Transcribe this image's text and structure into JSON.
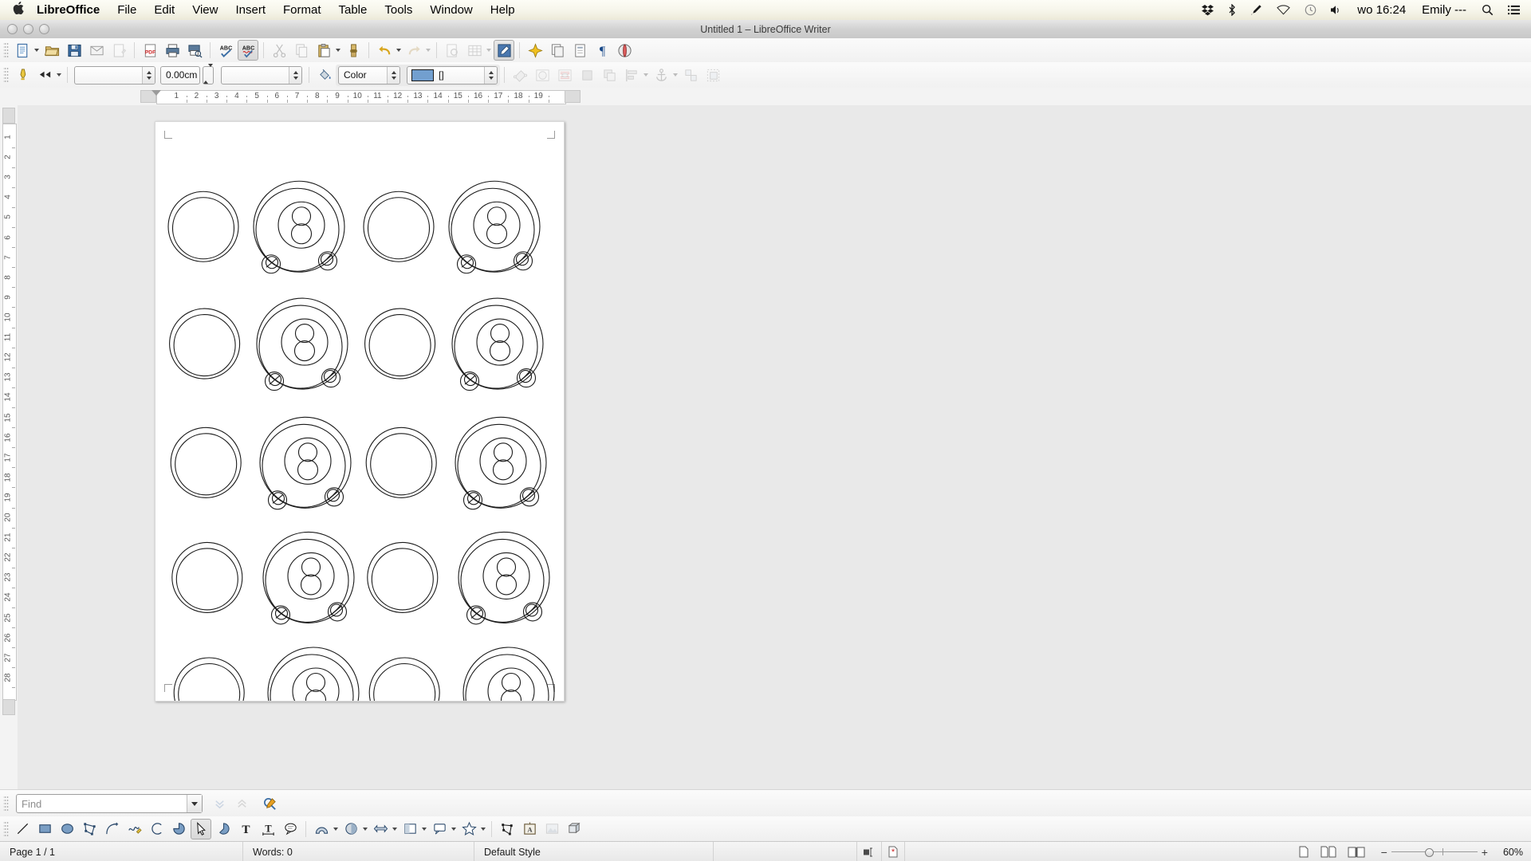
{
  "macbar": {
    "apple_icon": "apple-logo-icon",
    "app_name": "LibreOffice",
    "menus": [
      "File",
      "Edit",
      "View",
      "Insert",
      "Format",
      "Table",
      "Tools",
      "Window",
      "Help"
    ],
    "status_icons": [
      "dropbox-icon",
      "bluetooth-icon",
      "pen-icon",
      "wifi-icon",
      "time-machine-icon",
      "volume-icon"
    ],
    "clock": "wo 16:24",
    "user": "Emily ---",
    "search_icon": "spotlight-search-icon",
    "notification_icon": "notification-center-icon"
  },
  "titlebar": {
    "title": "Untitled 1 – LibreOffice Writer",
    "close_label": "close-window",
    "minimize_label": "minimize-window",
    "zoom_label": "zoom-window"
  },
  "toolbar_main": {
    "items": [
      {
        "name": "new-document-button",
        "tip": "New",
        "dropdown": true
      },
      {
        "name": "open-document-button",
        "tip": "Open"
      },
      {
        "name": "save-document-button",
        "tip": "Save"
      },
      {
        "name": "email-document-button",
        "tip": "Attach to E-mail"
      },
      {
        "name": "edit-mode-button",
        "tip": "Edit Mode",
        "dim": true
      },
      {
        "name": "export-pdf-button",
        "tip": "Export as PDF"
      },
      {
        "name": "print-button",
        "tip": "Print"
      },
      {
        "name": "print-preview-button",
        "tip": "Toggle Print Preview"
      },
      {
        "name": "spelling-button",
        "tip": "Spelling and Grammar"
      },
      {
        "name": "autospellcheck-button",
        "tip": "AutoSpellcheck",
        "active": true
      },
      {
        "name": "cut-button",
        "tip": "Cut",
        "dim": true
      },
      {
        "name": "copy-button",
        "tip": "Copy",
        "dim": true
      },
      {
        "name": "paste-button",
        "tip": "Paste",
        "dropdown": true
      },
      {
        "name": "clone-formatting-button",
        "tip": "Clone Formatting"
      },
      {
        "name": "undo-button",
        "tip": "Undo",
        "dropdown": true
      },
      {
        "name": "redo-button",
        "tip": "Redo",
        "dropdown": true,
        "dim": true
      },
      {
        "name": "find-replace-button",
        "tip": "Find and Replace",
        "dim": true
      },
      {
        "name": "insert-table-button",
        "tip": "Insert Table",
        "dropdown": true,
        "dim": true
      },
      {
        "name": "show-draw-functions-button",
        "tip": "Show Draw Functions",
        "active": true
      },
      {
        "name": "insert-special-character-button",
        "tip": "Insert Special Character"
      },
      {
        "name": "insert-page-break-button",
        "tip": "Insert Page Break"
      },
      {
        "name": "insert-field-button",
        "tip": "Insert Field"
      },
      {
        "name": "formatting-marks-button",
        "tip": "Formatting Marks"
      },
      {
        "name": "gallery-button",
        "tip": "Gallery"
      }
    ]
  },
  "toolbar_draw_props": {
    "line_color_button": "line-color-button",
    "arrow_style_button": "arrow-style-button",
    "line_style_value": "",
    "line_width_value": "0.00cm",
    "line_color_value": "",
    "fill_bucket_button": "area-style-fill-button",
    "fill_style_value": "Color",
    "fill_color_value": "[]",
    "fill_color_hex": "#729fcf",
    "right_items": [
      {
        "name": "rotate-button",
        "dim": true
      },
      {
        "name": "wrap-off-button",
        "dim": true
      },
      {
        "name": "wrap-parallel-button",
        "dim": true
      },
      {
        "name": "wrap-through-button",
        "dim": true
      },
      {
        "name": "bring-to-front-button",
        "dim": true
      },
      {
        "name": "align-objects-button",
        "dim": true,
        "dropdown": true
      },
      {
        "name": "anchor-button",
        "dim": true,
        "dropdown": true
      },
      {
        "name": "ungroup-button",
        "dim": true
      },
      {
        "name": "group-button",
        "dim": true
      }
    ]
  },
  "hruler": {
    "unit": "cm",
    "numbers": [
      1,
      2,
      3,
      4,
      5,
      6,
      7,
      8,
      9,
      10,
      11,
      12,
      13,
      14,
      15,
      16,
      17,
      18,
      19
    ],
    "indent_marker": "first-line-indent-marker"
  },
  "vruler": {
    "unit": "cm",
    "numbers": [
      1,
      2,
      3,
      4,
      5,
      6,
      7,
      8,
      9,
      10,
      11,
      12,
      13,
      14,
      15,
      16,
      17,
      18,
      19,
      20,
      21,
      22,
      23,
      24,
      25,
      26,
      27,
      28
    ]
  },
  "document": {
    "name": "writer-page-canvas",
    "page_color": "#ffffff",
    "shape_stroke": "#1a1a1a",
    "rows": 5,
    "cols": 4,
    "shapes_note": "alternating plain double-ring circles and detailed ring-with-inner-circles shapes"
  },
  "findbar": {
    "placeholder": "Find",
    "value": "",
    "dropdown_icon": "chevron-down-icon",
    "find_next_button": "find-next-button",
    "find_previous_button": "find-previous-button",
    "find_replace_button": "find-and-replace-button"
  },
  "drawbar": {
    "items": [
      {
        "name": "insert-line-tool",
        "tip": "Insert Line"
      },
      {
        "name": "rectangle-tool",
        "tip": "Rectangle"
      },
      {
        "name": "ellipse-tool",
        "tip": "Ellipse"
      },
      {
        "name": "polygon-tool",
        "tip": "Polygon"
      },
      {
        "name": "curve-tool",
        "tip": "Curve"
      },
      {
        "name": "freeform-line-tool",
        "tip": "Freeform Line"
      },
      {
        "name": "arc-tool",
        "tip": "Arc"
      },
      {
        "name": "ellipse-pie-tool",
        "tip": "Ellipse Pie"
      },
      {
        "name": "select-tool",
        "tip": "Select",
        "active": true
      },
      {
        "name": "basic-shapes-tool",
        "tip": "Basic Shapes"
      },
      {
        "name": "insert-text-box-tool",
        "tip": "Insert Text Box"
      },
      {
        "name": "vertical-text-tool",
        "tip": "Insert Text Box (fit to frame)"
      },
      {
        "name": "callout-tool",
        "tip": "Callouts"
      },
      {
        "name": "basic-shapes-menu",
        "tip": "Basic Shapes",
        "dropdown": true
      },
      {
        "name": "symbol-shapes-menu",
        "tip": "Symbol Shapes",
        "dropdown": true
      },
      {
        "name": "block-arrows-menu",
        "tip": "Block Arrows",
        "dropdown": true
      },
      {
        "name": "flowchart-shapes-menu",
        "tip": "Flowchart",
        "dropdown": true
      },
      {
        "name": "callout-shapes-menu",
        "tip": "Callouts",
        "dropdown": true
      },
      {
        "name": "stars-shapes-menu",
        "tip": "Stars",
        "dropdown": true
      },
      {
        "name": "edit-points-tool",
        "tip": "Points"
      },
      {
        "name": "fontwork-gallery-button",
        "tip": "Fontwork Gallery"
      },
      {
        "name": "insert-image-button",
        "tip": "From File",
        "dim": true
      },
      {
        "name": "extrusion-toggle-button",
        "tip": "Toggle Extrusion"
      }
    ]
  },
  "statusbar": {
    "page": "Page 1 / 1",
    "words": "Words: 0",
    "style": "Default Style",
    "language": "",
    "selection_mode_icon": "selection-mode-icon",
    "save_status_icon": "unsaved-changes-icon",
    "view_single_page": "single-page-view-button",
    "view_multi_page": "multiple-page-view-button",
    "view_book": "book-view-button",
    "zoom_out": "−",
    "zoom_in": "+",
    "zoom_level": "60%"
  }
}
